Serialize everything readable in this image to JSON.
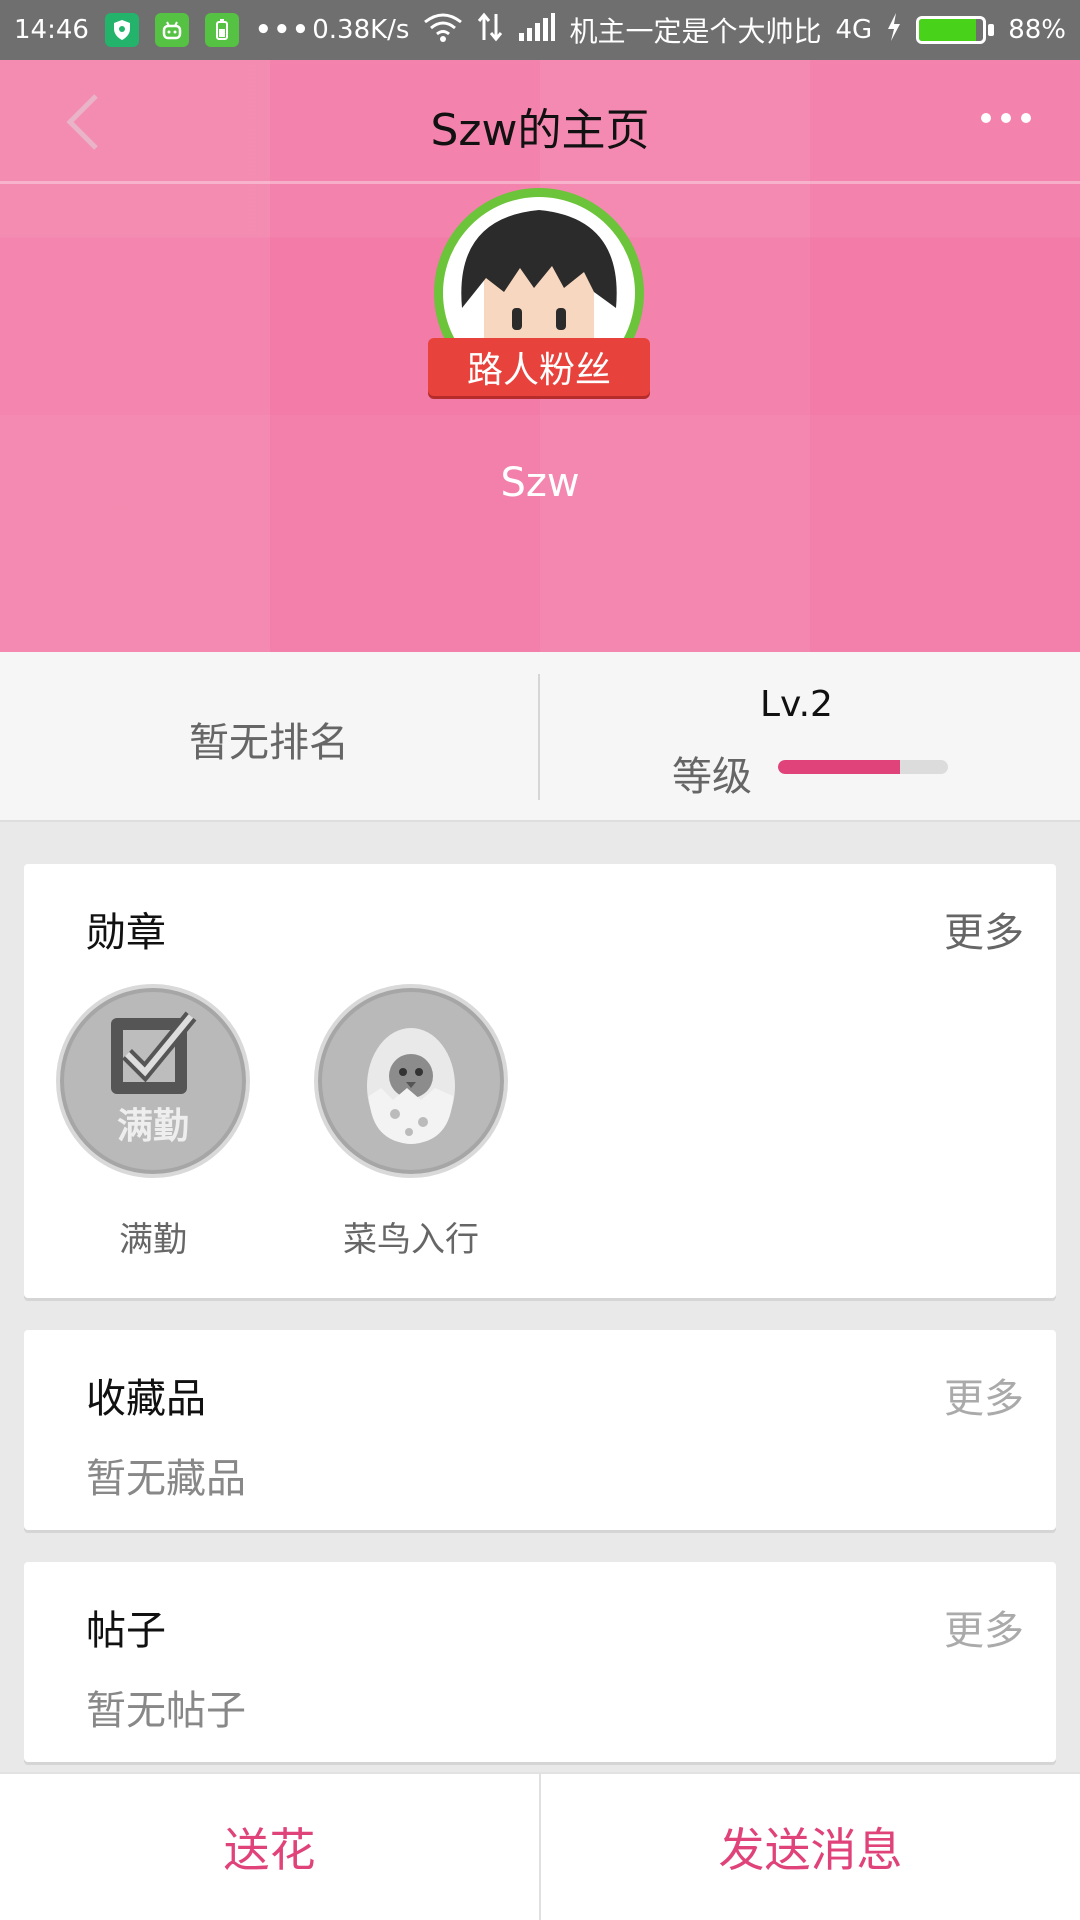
{
  "status_bar": {
    "time": "14:46",
    "net_speed": "0.38K/s",
    "carrier": "机主一定是个大帅比",
    "network": "4G",
    "battery_percent": 88,
    "battery_text": "88%",
    "icons": [
      "shield-icon",
      "android-icon",
      "battery-app-icon",
      "more-dots-icon",
      "wifi-icon",
      "data-arrows-icon",
      "signal-icon",
      "charging-icon"
    ]
  },
  "header": {
    "title": "Szw的主页",
    "back_icon": "chevron-left-icon",
    "more_icon": "more-horizontal-icon"
  },
  "profile": {
    "ribbon_label": "路人粉丝",
    "username": "Szw"
  },
  "stats": {
    "rank_text": "暂无排名",
    "level_value": "Lv.2",
    "level_label": "等级",
    "level_progress": 0.72
  },
  "medals": {
    "title": "勋章",
    "more": "更多",
    "items": [
      {
        "label": "满勤",
        "icon": "checkbox-medal-icon",
        "icon_text": "满勤"
      },
      {
        "label": "菜鸟入行",
        "icon": "chick-egg-medal-icon"
      }
    ]
  },
  "collections": {
    "title": "收藏品",
    "more": "更多",
    "empty": "暂无藏品"
  },
  "posts": {
    "title": "帖子",
    "more": "更多",
    "empty": "暂无帖子"
  },
  "bottom_bar": {
    "send_flower": "送花",
    "send_message": "发送消息"
  },
  "colors": {
    "accent": "#e0437a",
    "hero_pink": "#f27ba7",
    "status_bar": "#6f6f6f"
  }
}
